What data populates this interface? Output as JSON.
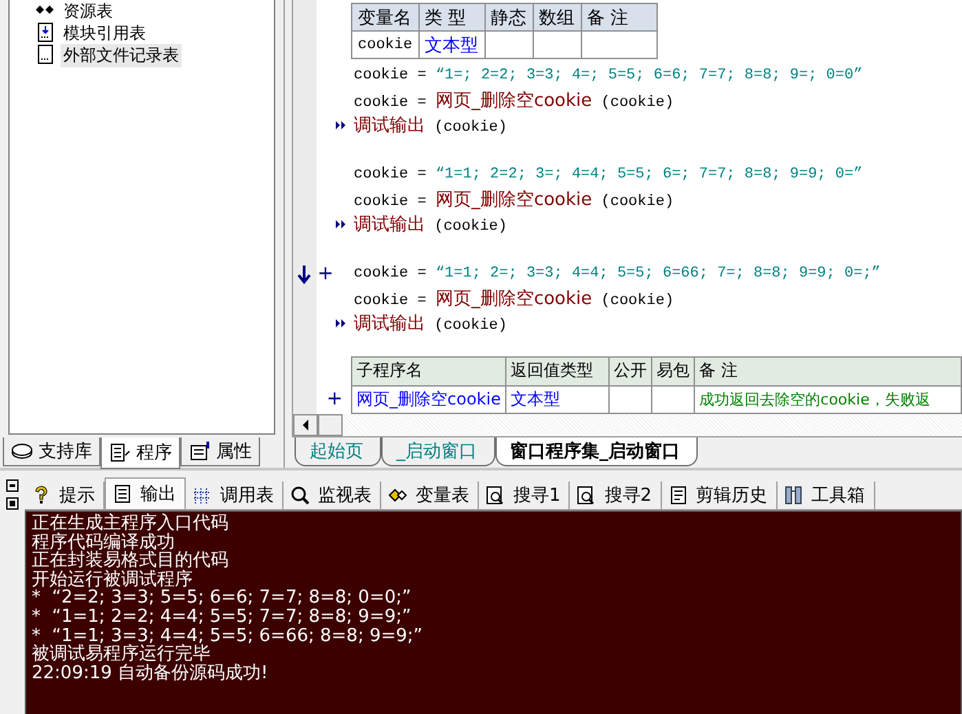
{
  "project_tree": {
    "items": [
      {
        "label": "资源表",
        "selected": false
      },
      {
        "label": "模块引用表",
        "selected": false
      },
      {
        "label": "外部文件记录表",
        "selected": true
      }
    ]
  },
  "left_tabs": [
    {
      "label": "支持库",
      "selected": false
    },
    {
      "label": "程序",
      "selected": true
    },
    {
      "label": "属性",
      "selected": false
    }
  ],
  "variable_table": {
    "columns": [
      "变量名",
      "类 型",
      "静态",
      "数组",
      "备 注"
    ],
    "rows": [
      {
        "name": "cookie",
        "type": "文本型"
      }
    ]
  },
  "code_blocks": [
    {
      "lines": [
        {
          "kind": "assign_string",
          "current": false,
          "target": "cookie",
          "operator": "=",
          "value": "“1=; 2=2; 3=3; 4=; 5=5; 6=6; 7=7; 8=8; 9=; 0=0”"
        },
        {
          "kind": "assign_call",
          "current": false,
          "target": "cookie",
          "operator": "=",
          "function": "网页_删除空cookie",
          "argument": "(cookie)"
        },
        {
          "kind": "command",
          "current": false,
          "function": "调试输出",
          "argument": "(cookie)"
        }
      ]
    },
    {
      "lines": [
        {
          "kind": "assign_string",
          "current": false,
          "target": "cookie",
          "operator": "=",
          "value": "“1=1; 2=2; 3=; 4=4; 5=5; 6=; 7=7; 8=8; 9=9; 0=”"
        },
        {
          "kind": "assign_call",
          "current": false,
          "target": "cookie",
          "operator": "=",
          "function": "网页_删除空cookie",
          "argument": "(cookie)"
        },
        {
          "kind": "command",
          "current": false,
          "function": "调试输出",
          "argument": "(cookie)"
        }
      ]
    },
    {
      "lines": [
        {
          "kind": "assign_string",
          "current": true,
          "prefix": "+",
          "target": "cookie",
          "operator": "=",
          "value": "“1=1; 2=; 3=3; 4=4; 5=5; 6=66; 7=; 8=8; 9=9; 0=;”"
        },
        {
          "kind": "assign_call",
          "current": false,
          "target": "cookie",
          "operator": "=",
          "function": "网页_删除空cookie",
          "argument": "(cookie)"
        },
        {
          "kind": "command",
          "current": false,
          "function": "调试输出",
          "argument": "(cookie)"
        }
      ]
    }
  ],
  "subroutine_table": {
    "columns": [
      "子程序名",
      "返回值类型",
      "公开",
      "易包",
      "备 注"
    ],
    "rows": [
      {
        "prefix": "+",
        "name": "网页_删除空cookie",
        "return_type": "文本型",
        "note": "成功返回去除空的cookie，失败返"
      }
    ]
  },
  "document_tabs": [
    {
      "label": "起始页",
      "selected": false
    },
    {
      "label": "_启动窗口",
      "selected": false
    },
    {
      "label": "窗口程序集_启动窗口",
      "selected": true
    }
  ],
  "output_tabs": [
    {
      "label": "提示",
      "selected": false
    },
    {
      "label": "输出",
      "selected": true
    },
    {
      "label": "调用表",
      "selected": false
    },
    {
      "label": "监视表",
      "selected": false
    },
    {
      "label": "变量表",
      "selected": false
    },
    {
      "label": "搜寻1",
      "selected": false
    },
    {
      "label": "搜寻2",
      "selected": false
    },
    {
      "label": "剪辑历史",
      "selected": false
    },
    {
      "label": "工具箱",
      "selected": false
    }
  ],
  "output_lines": [
    "正在生成主程序入口代码",
    "程序代码编译成功",
    "正在封装易格式目的代码",
    "开始运行被调试程序",
    "*  “2=2; 3=3; 5=5; 6=6; 7=7; 8=8; 0=0;”",
    "*  “1=1; 2=2; 4=4; 5=5; 7=7; 8=8; 9=9;”",
    "*  “1=1; 3=3; 4=4; 5=5; 6=66; 8=8; 9=9;”",
    "被调试易程序运行完毕",
    "22:09:19 自动备份源码成功!"
  ]
}
